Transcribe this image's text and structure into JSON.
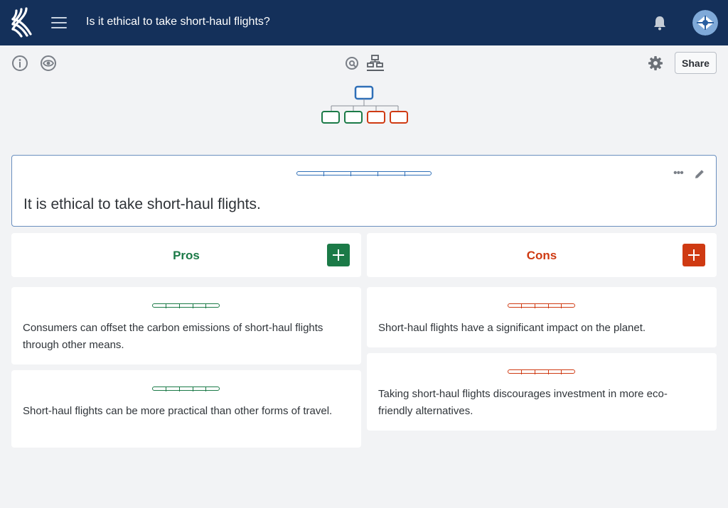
{
  "header": {
    "title": "Is it ethical to take short-haul flights?",
    "logo_icon": "kialo-logo-icon",
    "menu_icon": "hamburger-menu-icon",
    "bell_icon": "notification-bell-icon",
    "avatar_icon": "user-avatar-icon",
    "background": "#14305a"
  },
  "toolbar": {
    "info_icon": "info-icon",
    "view_icon": "eye-icon",
    "radial_view_icon": "radial-view-icon",
    "tree_view_icon": "tree-view-icon",
    "settings_icon": "gear-icon",
    "share_label": "Share"
  },
  "thesis": {
    "text": "It is ethical to take short-haul flights.",
    "accent": "#2f6fb7"
  },
  "pros": {
    "label": "Pros",
    "color": "#1b7a47",
    "items": [
      {
        "text": "Consumers can offset the carbon emissions of short-haul flights through other means."
      },
      {
        "text": "Short-haul flights can be more practical than other forms of travel."
      }
    ]
  },
  "cons": {
    "label": "Cons",
    "color": "#cf3a12",
    "items": [
      {
        "text": "Short-haul flights have a significant impact on the planet."
      },
      {
        "text": "Taking short-haul flights discourages investment in more eco-friendly alternatives."
      }
    ]
  }
}
